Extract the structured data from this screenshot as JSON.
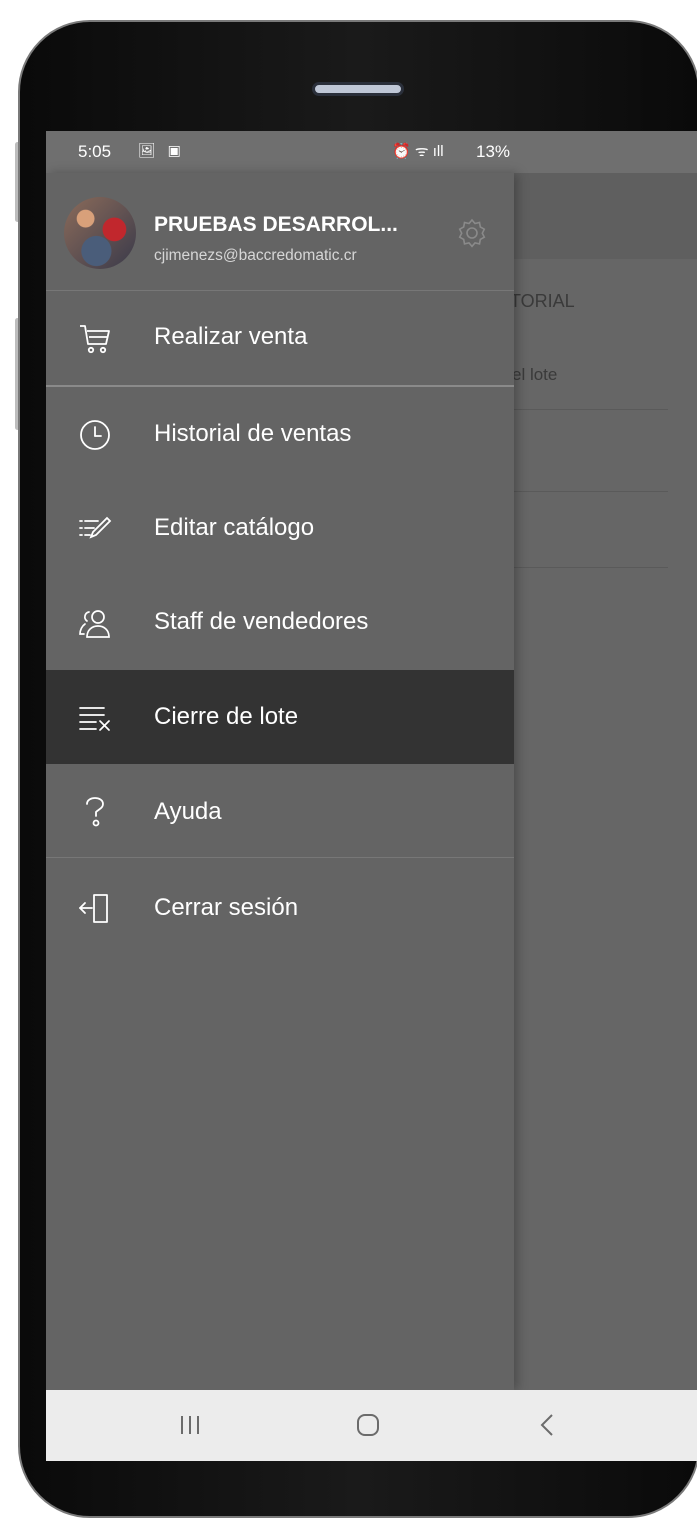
{
  "status_bar": {
    "time": "5:05",
    "left_icons": "🖼 ▣",
    "right_icons": "⏰ ᯤ ıll",
    "battery": "13%"
  },
  "background_app": {
    "tab_label": "TORIAL",
    "row_text": "el lote"
  },
  "drawer": {
    "profile": {
      "name": "PRUEBAS DESARROL...",
      "email": "cjimenezs@baccredomatic.cr"
    },
    "items": [
      {
        "label": "Realizar venta",
        "icon": "cart-icon",
        "active": false
      },
      {
        "label": "Historial de ventas",
        "icon": "clock-icon",
        "active": false
      },
      {
        "label": "Editar catálogo",
        "icon": "edit-list-icon",
        "active": false
      },
      {
        "label": "Staff de vendedores",
        "icon": "users-icon",
        "active": false
      },
      {
        "label": "Cierre de lote",
        "icon": "list-close-icon",
        "active": true
      },
      {
        "label": "Ayuda",
        "icon": "help-icon",
        "active": false
      },
      {
        "label": "Cerrar sesión",
        "icon": "logout-icon",
        "active": false
      }
    ]
  },
  "nav_bar": {
    "buttons": [
      "recent-apps-icon",
      "home-icon",
      "back-icon"
    ]
  },
  "colors": {
    "drawer_bg": "#646464",
    "active_item_bg": "#333333",
    "text": "#ffffff"
  }
}
